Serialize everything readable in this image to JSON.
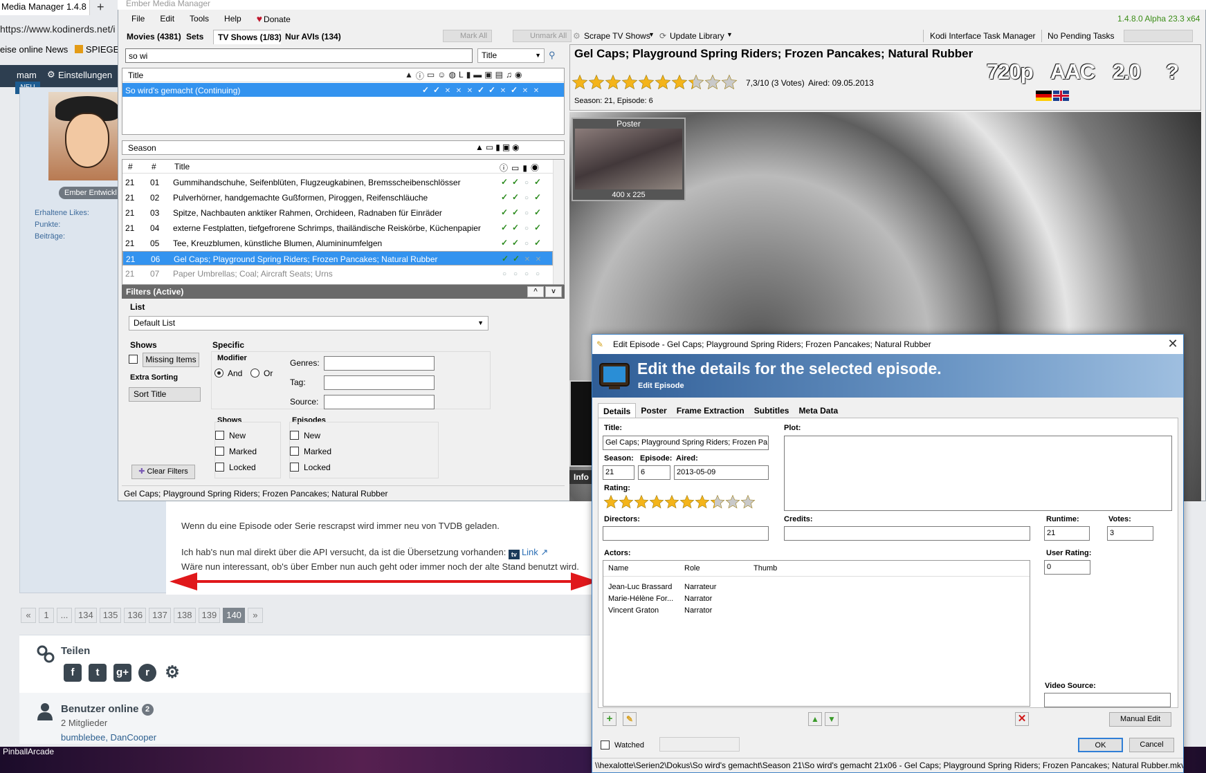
{
  "browser": {
    "tab_title": "Media Manager 1.4.8",
    "new_tab": "+",
    "url": "https://www.kodinerds.net/i",
    "bookmarks": [
      "eise online News",
      "SPIEGEL O"
    ],
    "nav": {
      "user": "mam",
      "settings": "Einstellungen"
    },
    "new_badge": "NEU",
    "role_badge": "Ember Entwickl",
    "stats": [
      "Erhaltene Likes:",
      "Punkte:",
      "Beiträge:"
    ],
    "post_lines": [
      "Wenn du eine Episode oder Serie rescrapst wird immer neu von TVDB geladen.",
      "Ich hab's nun mal direkt über die API versucht, da ist die Übersetzung vorhanden:",
      "Wäre nun interessant, ob's über Ember nun auch geht oder immer noch der alte Stand benutzt wird."
    ],
    "post_link_icon": "tv",
    "post_link": "Link",
    "pager": [
      "«",
      "1",
      "...",
      "134",
      "135",
      "136",
      "137",
      "138",
      "139",
      "140",
      "»"
    ],
    "pager_current": "140",
    "share_title": "Teilen",
    "share_icons": [
      "f",
      "t",
      "g+",
      "r",
      "⚙"
    ],
    "online_title": "Benutzer online",
    "online_count": "2",
    "online_sub": "2 Mitglieder",
    "online_users": "bumblebee, DanCooper",
    "taskbar_label": "PinballArcade"
  },
  "ember": {
    "title": "Ember Media Manager",
    "menu": [
      "File",
      "Edit",
      "Tools",
      "Help"
    ],
    "donate": "Donate",
    "version": "1.4.8.0 Alpha 23.3 x64",
    "tabs": [
      "Movies (4381)",
      "Sets",
      "TV Shows (1/83)",
      "Nur AVIs (134)"
    ],
    "active_tab": "TV Shows (1/83)",
    "toolbar": {
      "mark_all": "Mark All",
      "unmark_all": "Unmark All",
      "scrape": "Scrape TV Shows",
      "update": "Update Library",
      "kodi": "Kodi Interface Task Manager",
      "pending": "No Pending Tasks"
    },
    "search": {
      "value": "so wi",
      "field": "Title"
    },
    "show_list": {
      "header": "Title",
      "rows": [
        {
          "title": "So wird's gemacht (Continuing)"
        }
      ]
    },
    "season_list": {
      "header": "Season"
    },
    "episode_list": {
      "headers": [
        "#",
        "#",
        "Title"
      ],
      "rows": [
        {
          "s": "21",
          "e": "01",
          "title": "Gummihandschuhe, Seifenblüten, Flugzeugkabinen, Bremsscheibenschlösser"
        },
        {
          "s": "21",
          "e": "02",
          "title": "Pulverhörner, handgemachte Gußformen, Piroggen, Reifenschläuche"
        },
        {
          "s": "21",
          "e": "03",
          "title": "Spitze, Nachbauten anktiker Rahmen, Orchideen, Radnaben für Einräder"
        },
        {
          "s": "21",
          "e": "04",
          "title": "externe Festplatten, tiefgefrorene Schrimps, thailändische Reiskörbe, Küchenpapier"
        },
        {
          "s": "21",
          "e": "05",
          "title": "Tee, Kreuzblumen, künstliche Blumen, Alumininumfelgen"
        },
        {
          "s": "21",
          "e": "06",
          "title": "Gel Caps; Playground Spring Riders; Frozen Pancakes; Natural Rubber"
        },
        {
          "s": "21",
          "e": "07",
          "title": "Paper Umbrellas; Coal; Aircraft Seats; Urns"
        }
      ],
      "selected": 5
    },
    "filters": {
      "header": "Filters (Active)",
      "collapse": "^",
      "expand": "v",
      "list_label": "List",
      "list_value": "Default List",
      "shows_label": "Shows",
      "missing_items": "Missing Items",
      "extra_sorting": "Extra Sorting",
      "sort_title": "Sort Title",
      "specific": "Specific",
      "modifier": "Modifier",
      "and": "And",
      "or": "Or",
      "genres": "Genres:",
      "tag": "Tag:",
      "source": "Source:",
      "shows_group": "Shows",
      "episodes_group": "Episodes",
      "checks": [
        "New",
        "Marked",
        "Locked"
      ],
      "clear": "Clear Filters"
    },
    "status": "Gel Caps; Playground Spring Riders; Frozen Pancakes; Natural Rubber",
    "info": {
      "title": "Gel Caps; Playground Spring Riders; Frozen Pancakes; Natural Rubber",
      "rating_text": "7,3/10 (3 Votes)",
      "aired_text": "Aired: 09.05.2013",
      "rating": 7.3,
      "season_ep": "Season: 21, Episode: 6",
      "flags": [
        "720p",
        "AAC",
        "2.0",
        "?"
      ],
      "poster_label": "Poster",
      "poster_size": "400 x 225",
      "info_btn": "Info"
    }
  },
  "dialog": {
    "title": "Edit Episode - Gel Caps; Playground Spring Riders; Frozen Pancakes; Natural Rubber",
    "banner_title": "Edit the details for the selected episode.",
    "banner_sub": "Edit Episode",
    "tabs": [
      "Details",
      "Poster",
      "Frame Extraction",
      "Subtitles",
      "Meta Data"
    ],
    "labels": {
      "title": "Title:",
      "season": "Season:",
      "episode": "Episode:",
      "aired": "Aired:",
      "rating": "Rating:",
      "plot": "Plot:",
      "directors": "Directors:",
      "credits": "Credits:",
      "runtime": "Runtime:",
      "votes": "Votes:",
      "user_rating": "User Rating:",
      "actors": "Actors:",
      "video_source": "Video Source:"
    },
    "values": {
      "title": "Gel Caps; Playground Spring Riders; Frozen Pa",
      "season": "21",
      "episode": "6",
      "aired": "2013-05-09",
      "runtime": "21",
      "votes": "3",
      "user_rating": "0"
    },
    "rating": 7.3,
    "actors": {
      "headers": [
        "Name",
        "Role",
        "Thumb"
      ],
      "rows": [
        {
          "name": "Jean-Luc Brassard",
          "role": "Narrateur"
        },
        {
          "name": "Marie-Hélène For...",
          "role": "Narrator"
        },
        {
          "name": "Vincent Graton",
          "role": "Narrator"
        }
      ]
    },
    "manual_edit": "Manual Edit",
    "watched": "Watched",
    "ok": "OK",
    "cancel": "Cancel",
    "path": "\\\\hexalotte\\Serien2\\Dokus\\So wird's gemacht\\Season 21\\So wird's gemacht 21x06 - Gel Caps; Playground Spring Riders; Frozen Pancakes; Natural Rubber.mkv"
  }
}
